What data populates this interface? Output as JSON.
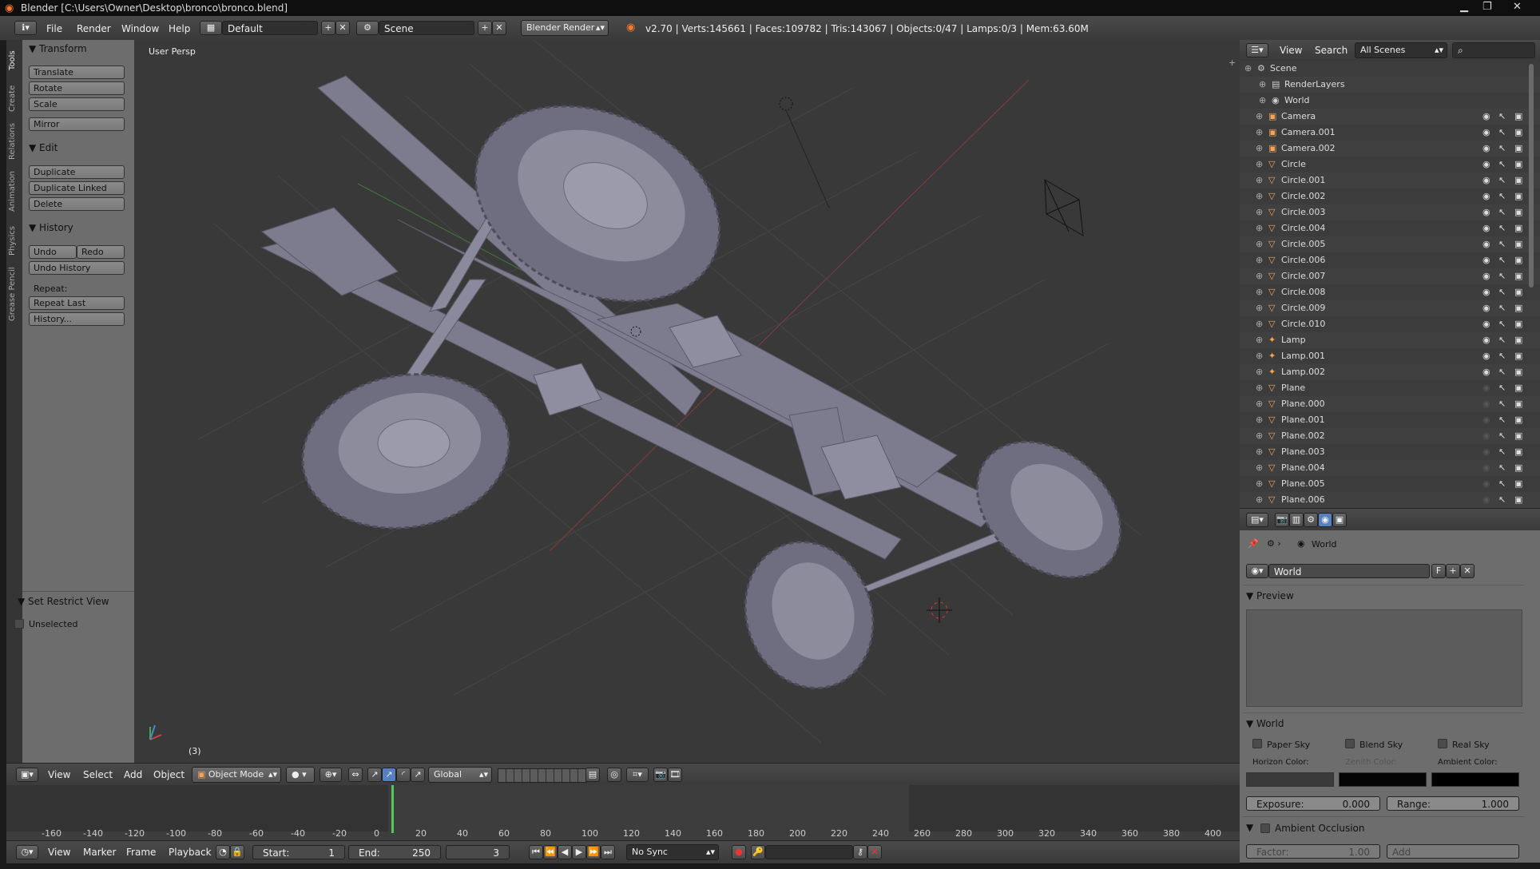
{
  "window": {
    "title": "Blender [C:\\Users\\Owner\\Desktop\\bronco\\bronco.blend]"
  },
  "topbar": {
    "menus": [
      "File",
      "Render",
      "Window",
      "Help"
    ],
    "layout": "Default",
    "scene": "Scene",
    "engine": "Blender Render",
    "stats": "v2.70 | Verts:145661 | Faces:109782 | Tris:143067 | Objects:0/47 | Lamps:0/3 | Mem:63.60M"
  },
  "left_tabs": [
    "Tools",
    "Create",
    "Relations",
    "Animation",
    "Physics",
    "Grease Pencil"
  ],
  "toolshelf": {
    "transform": {
      "title": "Transform",
      "buttons": [
        "Translate",
        "Rotate",
        "Scale",
        "Mirror"
      ]
    },
    "edit": {
      "title": "Edit",
      "buttons": [
        "Duplicate",
        "Duplicate Linked",
        "Delete"
      ]
    },
    "history": {
      "title": "History",
      "undo": "Undo",
      "redo": "Redo",
      "undo_history": "Undo History",
      "repeat_label": "Repeat:",
      "repeat_last": "Repeat Last",
      "history": "History..."
    },
    "restrict": {
      "title": "Set Restrict View",
      "unselected": "Unselected"
    }
  },
  "viewport": {
    "label": "User Persp",
    "frame_label": "(3)"
  },
  "viewport_header": {
    "menus": [
      "View",
      "Select",
      "Add",
      "Object"
    ],
    "mode": "Object Mode",
    "orientation": "Global"
  },
  "timeline": {
    "ticks": [
      "-160",
      "-140",
      "-120",
      "-100",
      "-80",
      "-60",
      "-40",
      "-20",
      "0",
      "20",
      "40",
      "60",
      "80",
      "100",
      "120",
      "140",
      "160",
      "180",
      "200",
      "220",
      "240",
      "260",
      "280",
      "300",
      "320",
      "340",
      "360",
      "380",
      "400"
    ],
    "current_frame": 3
  },
  "timeline_header": {
    "menus": [
      "View",
      "Marker",
      "Frame",
      "Playback"
    ],
    "start_label": "Start:",
    "start": "1",
    "end_label": "End:",
    "end": "250",
    "current": "3",
    "sync": "No Sync"
  },
  "outliner": {
    "menus": [
      "View",
      "Search"
    ],
    "filter": "All Scenes",
    "items": [
      "Scene",
      "RenderLayers",
      "World",
      "Camera",
      "Camera.001",
      "Camera.002",
      "Circle",
      "Circle.001",
      "Circle.002",
      "Circle.003",
      "Circle.004",
      "Circle.005",
      "Circle.006",
      "Circle.007",
      "Circle.008",
      "Circle.009",
      "Circle.010",
      "Lamp",
      "Lamp.001",
      "Lamp.002",
      "Plane",
      "Plane.000",
      "Plane.001",
      "Plane.002",
      "Plane.003",
      "Plane.004",
      "Plane.005",
      "Plane.006"
    ]
  },
  "properties": {
    "breadcrumb": "World",
    "world_name": "World",
    "fake_user": "F",
    "preview_title": "Preview",
    "world_panel_title": "World",
    "paper_sky": "Paper Sky",
    "blend_sky": "Blend Sky",
    "real_sky": "Real Sky",
    "horizon_color": "Horizon Color:",
    "zenith_color": "Zenith Color:",
    "ambient_color": "Ambient Color:",
    "exposure_label": "Exposure:",
    "exposure": "0.000",
    "range_label": "Range:",
    "range": "1.000",
    "ao_title": "Ambient Occlusion",
    "factor_label": "Factor:",
    "factor": "1.00",
    "add_label": "Add",
    "colors": {
      "horizon": "#3a3a3a",
      "zenith": "#050505",
      "ambient": "#000000"
    }
  }
}
